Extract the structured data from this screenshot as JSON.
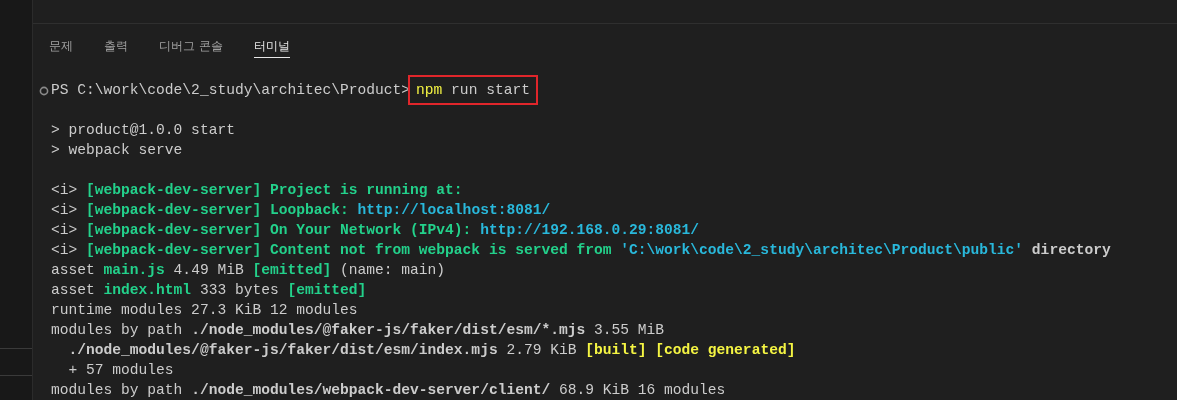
{
  "panel_tabs": [
    {
      "label": "문제",
      "selected": false
    },
    {
      "label": "출력",
      "selected": false
    },
    {
      "label": "디버그 콘솔",
      "selected": false
    },
    {
      "label": "터미널",
      "selected": true
    }
  ],
  "terminal": {
    "prompt": {
      "path": "PS C:\\work\\code\\2_study\\architec\\Product>",
      "command": [
        {
          "text": "npm",
          "kind": "yellow"
        },
        {
          "text": " run start",
          "kind": "plain"
        }
      ],
      "highlighted": true
    },
    "output_blocks": [
      {
        "lines": [
          {
            "segments": [
              {
                "text": "> product@1.0.0 start",
                "kind": "plain"
              }
            ]
          },
          {
            "segments": [
              {
                "text": "> webpack serve",
                "kind": "plain"
              }
            ]
          }
        ]
      },
      {
        "lines": [
          {
            "segments": [
              {
                "text": "<i> ",
                "kind": "plain"
              },
              {
                "text": "[webpack-dev-server] Project is running at:",
                "kind": "green-bold"
              }
            ]
          },
          {
            "segments": [
              {
                "text": "<i> ",
                "kind": "plain"
              },
              {
                "text": "[webpack-dev-server] Loopback: ",
                "kind": "green-bold"
              },
              {
                "text": "http://localhost:8081/",
                "kind": "cyan-bold"
              }
            ]
          },
          {
            "segments": [
              {
                "text": "<i> ",
                "kind": "plain"
              },
              {
                "text": "[webpack-dev-server] On Your Network (IPv4): ",
                "kind": "green-bold"
              },
              {
                "text": "http://192.168.0.29:8081/",
                "kind": "cyan-bold"
              }
            ]
          },
          {
            "segments": [
              {
                "text": "<i> ",
                "kind": "plain"
              },
              {
                "text": "[webpack-dev-server] Content not from webpack is served from ",
                "kind": "green-bold"
              },
              {
                "text": "'C:\\work\\code\\2_study\\architec\\Product\\public'",
                "kind": "cyan-bold"
              },
              {
                "text": " directory",
                "kind": "bold"
              }
            ]
          },
          {
            "segments": [
              {
                "text": "asset ",
                "kind": "plain"
              },
              {
                "text": "main.js",
                "kind": "green-bold"
              },
              {
                "text": " 4.49 MiB ",
                "kind": "plain"
              },
              {
                "text": "[emitted]",
                "kind": "green-bold"
              },
              {
                "text": " (name: main)",
                "kind": "plain"
              }
            ]
          },
          {
            "segments": [
              {
                "text": "asset ",
                "kind": "plain"
              },
              {
                "text": "index.html",
                "kind": "green-bold"
              },
              {
                "text": " 333 bytes ",
                "kind": "plain"
              },
              {
                "text": "[emitted]",
                "kind": "green-bold"
              }
            ]
          },
          {
            "segments": [
              {
                "text": "runtime modules 27.3 KiB 12 modules",
                "kind": "plain"
              }
            ]
          },
          {
            "segments": [
              {
                "text": "modules by path ",
                "kind": "plain"
              },
              {
                "text": "./node_modules/@faker-js/faker/dist/esm/*.mjs",
                "kind": "bold"
              },
              {
                "text": " 3.55 MiB",
                "kind": "plain"
              }
            ]
          },
          {
            "segments": [
              {
                "text": "  ./node_modules/@faker-js/faker/dist/esm/index.mjs",
                "kind": "bold"
              },
              {
                "text": " 2.79 KiB ",
                "kind": "plain"
              },
              {
                "text": "[built] [code generated]",
                "kind": "yellow-bold"
              }
            ]
          },
          {
            "segments": [
              {
                "text": "  + 57 modules",
                "kind": "plain"
              }
            ]
          },
          {
            "segments": [
              {
                "text": "modules by path ",
                "kind": "plain"
              },
              {
                "text": "./node_modules/webpack-dev-server/client/",
                "kind": "bold"
              },
              {
                "text": " 68.9 KiB 16 modules",
                "kind": "plain"
              }
            ]
          }
        ]
      }
    ]
  }
}
